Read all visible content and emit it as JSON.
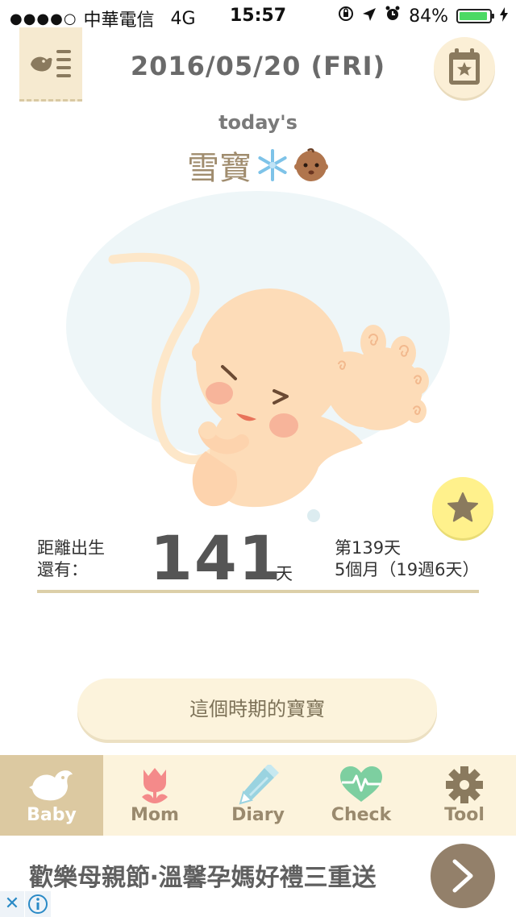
{
  "status_bar": {
    "signal": "●●●●○",
    "carrier": "中華電信",
    "network": "4G",
    "time": "15:57",
    "battery": "84%",
    "battery_level": 0.84,
    "icons": [
      "rotation-lock-icon",
      "location-icon",
      "alarm-icon",
      "battery-icon",
      "charging-icon"
    ]
  },
  "header": {
    "date": "2016/05/20 (FRI)",
    "menu_icon": "bird-menu-icon",
    "calendar_icon": "calendar-star-icon"
  },
  "profile": {
    "today_label": "today's",
    "baby_name": "雪寶",
    "emojis": [
      "snowflake-icon",
      "baby-face-icon"
    ]
  },
  "countdown": {
    "label_line1": "距離出生",
    "label_line2": "還有：",
    "days_remaining": "141",
    "unit": "天",
    "day_of_pregnancy": "第139天",
    "month_week": "5個月（19週6天）"
  },
  "period_button": {
    "label": "這個時期的寶寶"
  },
  "tabs": [
    {
      "label": "Baby",
      "icon": "bird-icon",
      "active": true
    },
    {
      "label": "Mom",
      "icon": "tulip-icon",
      "active": false
    },
    {
      "label": "Diary",
      "icon": "pencil-icon",
      "active": false
    },
    {
      "label": "Check",
      "icon": "heartbeat-icon",
      "active": false
    },
    {
      "label": "Tool",
      "icon": "gear-icon",
      "active": false
    }
  ],
  "ad": {
    "text": "歡樂母親節‧溫馨孕媽好禮三重送",
    "close_symbol": "✕"
  },
  "colors": {
    "accent_beige": "#dcc9a1",
    "tab_bg": "#fcf3dc",
    "star_yellow": "#fff18c",
    "ad_button": "#93806a"
  }
}
